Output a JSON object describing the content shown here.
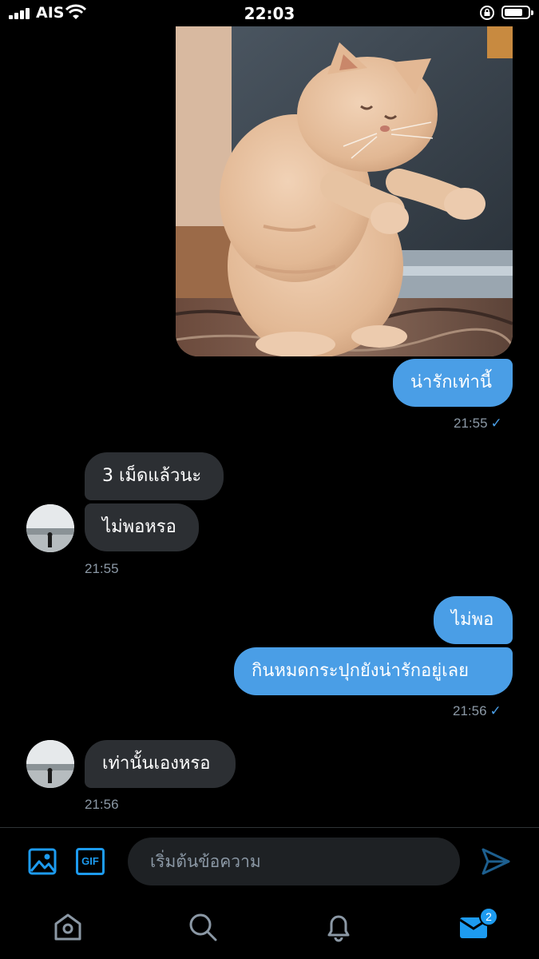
{
  "status_bar": {
    "carrier": "AIS",
    "time": "22:03"
  },
  "conversation": {
    "messages": [
      {
        "direction": "outgoing",
        "type": "image",
        "image_icon": "cat-photo"
      },
      {
        "direction": "outgoing",
        "text": "น่ารักเท่านี้"
      },
      {
        "direction": "outgoing",
        "timestamp": "21:55",
        "read_icon": "check-icon"
      },
      {
        "direction": "incoming",
        "text": "3 เม็ดแล้วนะ"
      },
      {
        "direction": "incoming",
        "text": "ไม่พอหรอ"
      },
      {
        "direction": "incoming",
        "timestamp": "21:55"
      },
      {
        "direction": "outgoing",
        "text": "ไม่พอ"
      },
      {
        "direction": "outgoing",
        "text": "กินหมดกระปุกยังน่ารักอยู่เลย"
      },
      {
        "direction": "outgoing",
        "timestamp": "21:56",
        "read_icon": "check-icon"
      },
      {
        "direction": "incoming",
        "text": "เท่านั้นเองหรอ"
      },
      {
        "direction": "incoming",
        "timestamp": "21:56"
      }
    ],
    "check_mark": "✓"
  },
  "composer": {
    "placeholder": "เริ่มต้นข้อความ",
    "gif_label": "GIF",
    "icons": [
      "image-icon",
      "gif-icon",
      "send-icon"
    ]
  },
  "tab_bar": {
    "icons": [
      "home-icon",
      "search-icon",
      "bell-icon",
      "mail-icon"
    ],
    "messages_badge": "2"
  },
  "colors": {
    "background": "#000000",
    "outgoing_bubble": "#4a9ee6",
    "incoming_bubble": "#2c2f33",
    "accent": "#1d9bf0",
    "muted_text": "#8b98a5"
  }
}
